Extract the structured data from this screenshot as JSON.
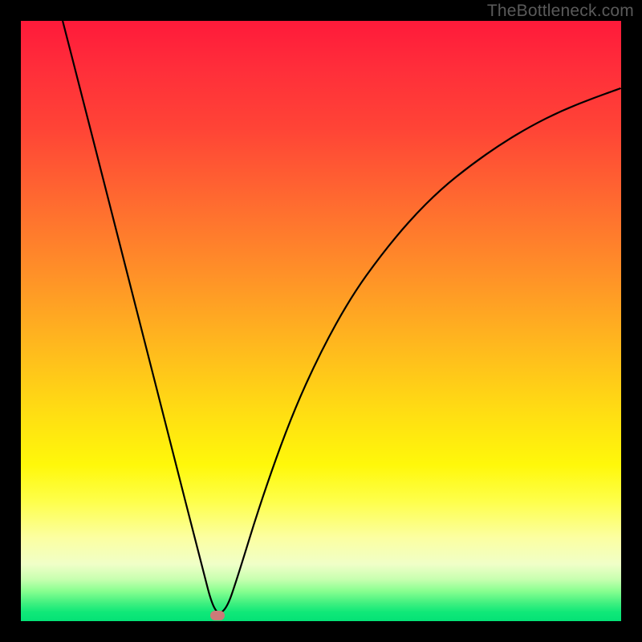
{
  "watermark": "TheBottleneck.com",
  "chart_data": {
    "type": "line",
    "title": "",
    "xlabel": "",
    "ylabel": "",
    "xlim": [
      0,
      1
    ],
    "ylim": [
      0,
      1
    ],
    "background_gradient": {
      "top": "#ff1a3a",
      "middle": "#fff80a",
      "bottom": "#04e276"
    },
    "series": [
      {
        "name": "bottleneck-curve",
        "color": "#000000",
        "x": [
          0.0696,
          0.1,
          0.15,
          0.2,
          0.25,
          0.3,
          0.323,
          0.342,
          0.36,
          0.4,
          0.45,
          0.5,
          0.55,
          0.6,
          0.65,
          0.7,
          0.75,
          0.8,
          0.85,
          0.9,
          0.95,
          1.0
        ],
        "values": [
          1.0,
          0.882,
          0.686,
          0.49,
          0.294,
          0.098,
          0.01,
          0.018,
          0.07,
          0.2,
          0.34,
          0.45,
          0.54,
          0.61,
          0.67,
          0.72,
          0.76,
          0.795,
          0.825,
          0.85,
          0.87,
          0.888
        ]
      }
    ],
    "marker": {
      "name": "optimal-point",
      "x": 0.327,
      "y": 0.009,
      "color": "#cc7a78"
    }
  }
}
